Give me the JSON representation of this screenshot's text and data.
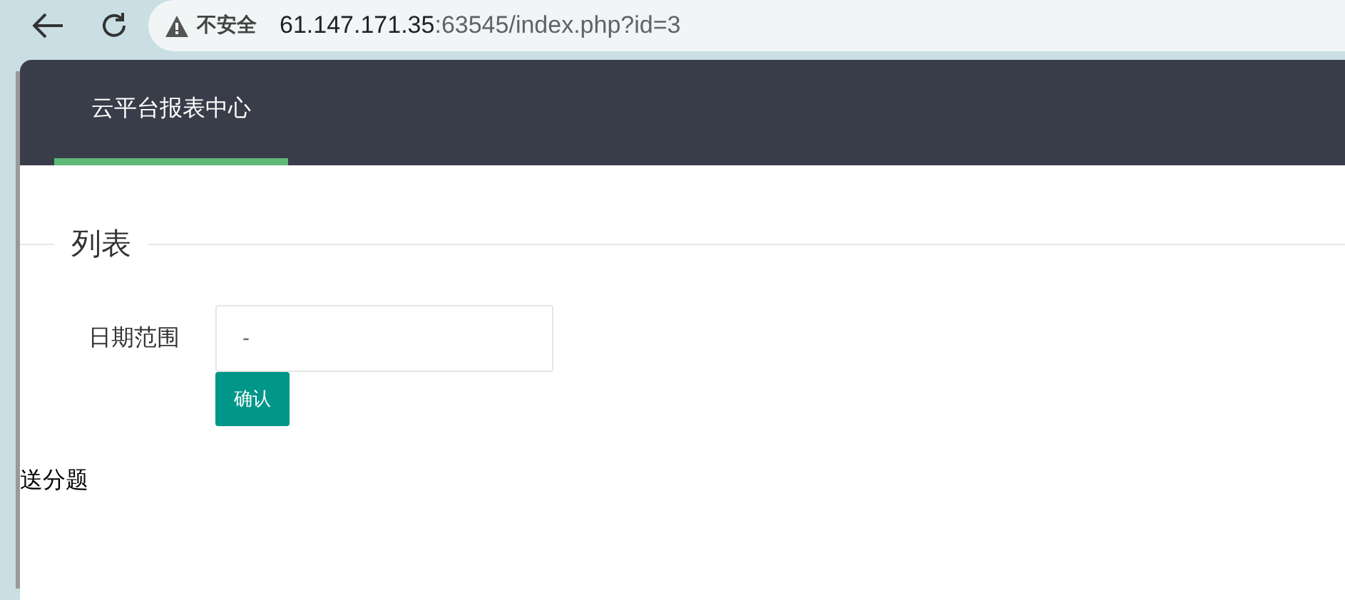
{
  "browser": {
    "security_label": "不安全",
    "url_host": "61.147.171.35",
    "url_rest": ":63545/index.php?id=3"
  },
  "nav": {
    "tabs": [
      {
        "label": "云平台报表中心",
        "selected": true
      }
    ]
  },
  "fieldset": {
    "legend": "列表"
  },
  "form": {
    "label": "日期范围",
    "value": "-",
    "button": "确认"
  },
  "body_text": "送分题"
}
